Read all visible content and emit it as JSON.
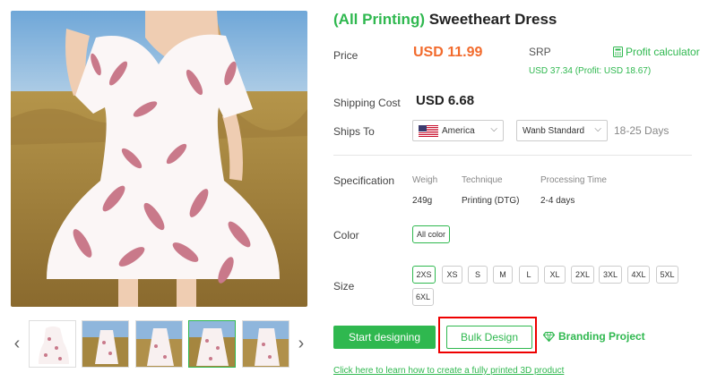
{
  "product": {
    "title_tag": "(All Printing)",
    "title_name": " Sweetheart Dress"
  },
  "price": {
    "label": "Price",
    "value": "USD 11.99",
    "srp_label": "SRP",
    "profit_calculator": "Profit calculator",
    "srp_value": "USD 37.34 (Profit: USD 18.67)"
  },
  "shipping": {
    "cost_label": "Shipping Cost",
    "cost_value": "USD 6.68",
    "ships_to_label": "Ships To",
    "country": "America",
    "method": "Wanb Standard",
    "days": "18-25 Days"
  },
  "specification": {
    "label": "Specification",
    "headers": [
      "Weigh",
      "Technique",
      "Processing Time"
    ],
    "values": [
      "249g",
      "Printing (DTG)",
      "2-4 days"
    ]
  },
  "color": {
    "label": "Color",
    "option": "All color"
  },
  "size": {
    "label": "Size",
    "options": [
      "2XS",
      "XS",
      "S",
      "M",
      "L",
      "XL",
      "2XL",
      "3XL",
      "4XL",
      "5XL",
      "6XL"
    ],
    "selected": "2XS"
  },
  "actions": {
    "start_designing": "Start designing",
    "bulk_design": "Bulk Design",
    "branding_project": "Branding Project",
    "learn_link": "Click here to learn how to create a fully printed 3D product"
  },
  "gallery": {
    "thumbnail_count": 5,
    "active_thumbnail": 4
  },
  "colors": {
    "accent_green": "#2fb84f",
    "price_orange": "#f26b2d",
    "highlight_red": "#e00000",
    "leaf_pink": "#c9798a"
  },
  "icons": [
    "chevron-left-icon",
    "chevron-right-icon",
    "calculator-icon",
    "us-flag-icon",
    "chevron-down-icon",
    "diamond-icon"
  ]
}
